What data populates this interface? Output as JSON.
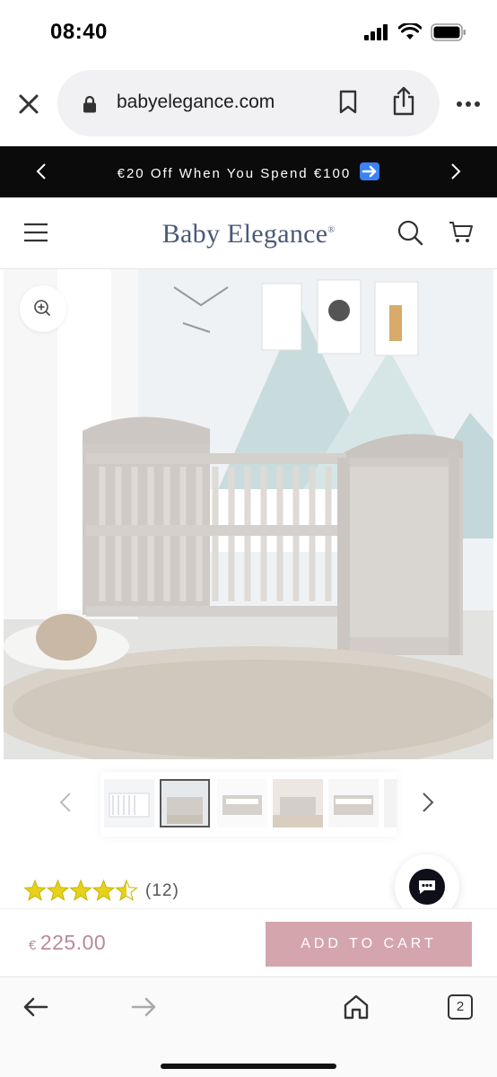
{
  "status_bar": {
    "time": "08:40"
  },
  "browser": {
    "url": "babyelegance.com",
    "open_tabs": "2"
  },
  "promo": {
    "text": "€20 Off When You Spend €100",
    "arrow_emoji_color": "#3b82f6"
  },
  "site": {
    "logo_text": "Baby Elegance",
    "logo_mark": "®",
    "brand_color": "#4a5a76"
  },
  "product": {
    "rating_stars": 4.5,
    "rating_max": 5,
    "review_count": "(12)",
    "currency_symbol": "€",
    "price": "225.00",
    "add_to_cart_label": "ADD TO CART",
    "accent_color": "#d5a5ae",
    "price_color": "#b98a96",
    "thumbnails": [
      {
        "name": "white-cot",
        "active": false
      },
      {
        "name": "grey-cot-room",
        "active": true
      },
      {
        "name": "grey-cot-side",
        "active": false
      },
      {
        "name": "grey-cot-bedroom",
        "active": false
      },
      {
        "name": "grey-cot-angle",
        "active": false
      }
    ]
  },
  "icons": {
    "close": "close-icon",
    "lock": "lock-icon",
    "bookmark": "bookmark-icon",
    "share": "share-icon",
    "more": "more-icon",
    "menu": "hamburger-icon",
    "search": "search-icon",
    "cart": "cart-icon",
    "zoom": "zoom-icon",
    "chat": "chat-icon",
    "back": "back-arrow-icon",
    "forward": "forward-arrow-icon",
    "home": "home-icon",
    "tabs": "tabs-icon"
  }
}
